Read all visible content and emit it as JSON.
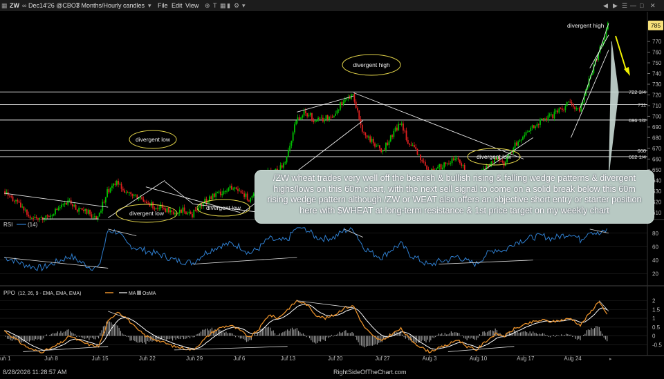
{
  "toolbar": {
    "symbol": "ZW",
    "contract": "Dec14'26 @CBOT",
    "period": "3 Months/Hourly candles",
    "menu": [
      "File",
      "Edit",
      "View"
    ]
  },
  "footer": {
    "timestamp": "8/28/2026 11:28:57 AM",
    "site": "RightSideOfTheChart.com"
  },
  "caption": "/ZW wheat trades very well off the bearish & bullish rising & falling wedge patterns & divergent highs/lows on this 60m chart, with the next sell signal to come on a solid break below this 60m rising wedge pattern although /ZW or WEAT also offers an objective short entry or starter position here with $WHEAT at long-term resistance & 1st price target on my weekly chart",
  "colors": {
    "candle_up": "#00c000",
    "candle_down": "#e02020",
    "rsi": "#2f7fd0",
    "ppo": "#e8902a",
    "ppo_signal": "#ffffff",
    "level_line": "#ffffff",
    "annotation": "#e4d54a",
    "arrow": "#f0f000",
    "current_price_tag": "#f6e07a"
  },
  "chart_data": [
    {
      "type": "candlestick",
      "panel": "price",
      "current_price": "785",
      "ylim": [
        606,
        792
      ],
      "y_ticks": [
        610,
        620,
        630,
        640,
        650,
        660,
        670,
        680,
        690,
        700,
        710,
        720,
        730,
        740,
        750,
        760,
        770
      ],
      "x_ticks": [
        "Jun 1",
        "Jun 8",
        "Jun 15",
        "Jun 22",
        "Jun 29",
        "Jul 6",
        "Jul 13",
        "Jul 20",
        "Jul 27",
        "Aug 3",
        "Aug 10",
        "Aug 17",
        "Aug 24"
      ],
      "horizontal_levels": [
        {
          "label": "722 3/4",
          "value": 722.75
        },
        {
          "label": "711",
          "value": 711
        },
        {
          "label": "696 1/2",
          "value": 696.5
        },
        {
          "label": "668",
          "value": 668
        },
        {
          "label": "662 1/4",
          "value": 662.25
        }
      ],
      "close_path": [
        [
          "Jun 1",
          630
        ],
        [
          "Jun 2",
          623
        ],
        [
          "Jun 3",
          614
        ],
        [
          "Jun 4",
          606
        ],
        [
          "Jun 5",
          604
        ],
        [
          "Jun 8",
          609
        ],
        [
          "Jun 9",
          615
        ],
        [
          "Jun 10",
          620
        ],
        [
          "Jun 11",
          612
        ],
        [
          "Jun 12",
          610
        ],
        [
          "Jun 15",
          604
        ],
        [
          "Jun 16",
          630
        ],
        [
          "Jun 17",
          639
        ],
        [
          "Jun 18",
          630
        ],
        [
          "Jun 19",
          624
        ],
        [
          "Jun 22",
          620
        ],
        [
          "Jun 23",
          616
        ],
        [
          "Jun 24",
          614
        ],
        [
          "Jun 25",
          607
        ],
        [
          "Jun 26",
          612
        ],
        [
          "Jun 29",
          608
        ],
        [
          "Jun 30",
          618
        ],
        [
          "Jul 1",
          625
        ],
        [
          "Jul 2",
          629
        ],
        [
          "Jul 3",
          633
        ],
        [
          "Jul 6",
          630
        ],
        [
          "Jul 7",
          622
        ],
        [
          "Jul 8",
          632
        ],
        [
          "Jul 9",
          651
        ],
        [
          "Jul 10",
          648
        ],
        [
          "Jul 13",
          660
        ],
        [
          "Jul 14",
          698
        ],
        [
          "Jul 15",
          704
        ],
        [
          "Jul 16",
          696
        ],
        [
          "Jul 17",
          698
        ],
        [
          "Jul 20",
          702
        ],
        [
          "Jul 21",
          716
        ],
        [
          "Jul 22",
          719
        ],
        [
          "Jul 23",
          686
        ],
        [
          "Jul 24",
          676
        ],
        [
          "Jul 27",
          667
        ],
        [
          "Jul 28",
          680
        ],
        [
          "Jul 29",
          694
        ],
        [
          "Jul 30",
          674
        ],
        [
          "Jul 31",
          664
        ],
        [
          "Aug 3",
          648
        ],
        [
          "Aug 4",
          652
        ],
        [
          "Aug 5",
          656
        ],
        [
          "Aug 6",
          662
        ],
        [
          "Aug 7",
          648
        ],
        [
          "Aug 10",
          642
        ],
        [
          "Aug 11",
          652
        ],
        [
          "Aug 12",
          660
        ],
        [
          "Aug 13",
          656
        ],
        [
          "Aug 14",
          671
        ],
        [
          "Aug 17",
          680
        ],
        [
          "Aug 18",
          690
        ],
        [
          "Aug 19",
          696
        ],
        [
          "Aug 20",
          700
        ],
        [
          "Aug 21",
          706
        ],
        [
          "Aug 24",
          713
        ],
        [
          "Aug 25",
          706
        ],
        [
          "Aug 26",
          733
        ],
        [
          "Aug 27",
          760
        ],
        [
          "Aug 28",
          785
        ]
      ],
      "annotations": [
        "divergent high",
        "divergent low",
        "divergent low",
        "divergent low",
        "divergent high",
        "divergent high",
        "divergent low"
      ]
    },
    {
      "type": "line",
      "panel": "rsi",
      "indicator": "RSI",
      "params": "(14)",
      "ylim": [
        10,
        90
      ],
      "y_ticks": [
        20,
        40,
        60,
        80
      ],
      "values": [
        44,
        40,
        34,
        30,
        28,
        34,
        40,
        46,
        38,
        30,
        28,
        84,
        82,
        64,
        58,
        54,
        50,
        46,
        40,
        38,
        36,
        48,
        56,
        62,
        64,
        60,
        50,
        58,
        72,
        68,
        70,
        90,
        86,
        74,
        72,
        74,
        84,
        86,
        60,
        50,
        44,
        56,
        64,
        48,
        40,
        32,
        38,
        40,
        46,
        38,
        34,
        48,
        56,
        54,
        66,
        70,
        74,
        76,
        72,
        76,
        80,
        70,
        84,
        78,
        86
      ]
    },
    {
      "type": "line",
      "panel": "ppo",
      "indicator": "PPO",
      "params": "(12, 26, 9 - EMA, EMA, EMA)",
      "legend": [
        "PPO",
        "MA",
        "OsMA"
      ],
      "ylim": [
        -1.0,
        2.3
      ],
      "y_ticks": [
        -0.5,
        0.0,
        0.5,
        1.0,
        1.5,
        2.0
      ],
      "values": [
        0.3,
        -0.1,
        -0.5,
        -0.8,
        -0.9,
        -0.7,
        -0.4,
        0.0,
        -0.3,
        -0.5,
        -0.6,
        0.8,
        1.4,
        1.0,
        0.4,
        0.0,
        -0.2,
        -0.4,
        -0.6,
        -0.7,
        -0.8,
        -0.3,
        0.2,
        0.5,
        0.6,
        0.3,
        -0.1,
        0.4,
        1.2,
        1.0,
        1.5,
        2.0,
        1.8,
        1.2,
        1.0,
        1.2,
        1.6,
        1.7,
        0.6,
        0.0,
        -0.3,
        0.1,
        0.4,
        -0.2,
        -0.6,
        -0.9,
        -0.7,
        -0.5,
        -0.2,
        -0.6,
        -0.8,
        -0.3,
        0.1,
        0.0,
        0.4,
        0.6,
        0.8,
        0.9,
        0.8,
        0.9,
        1.0,
        0.6,
        1.3,
        2.0,
        1.0
      ]
    }
  ]
}
